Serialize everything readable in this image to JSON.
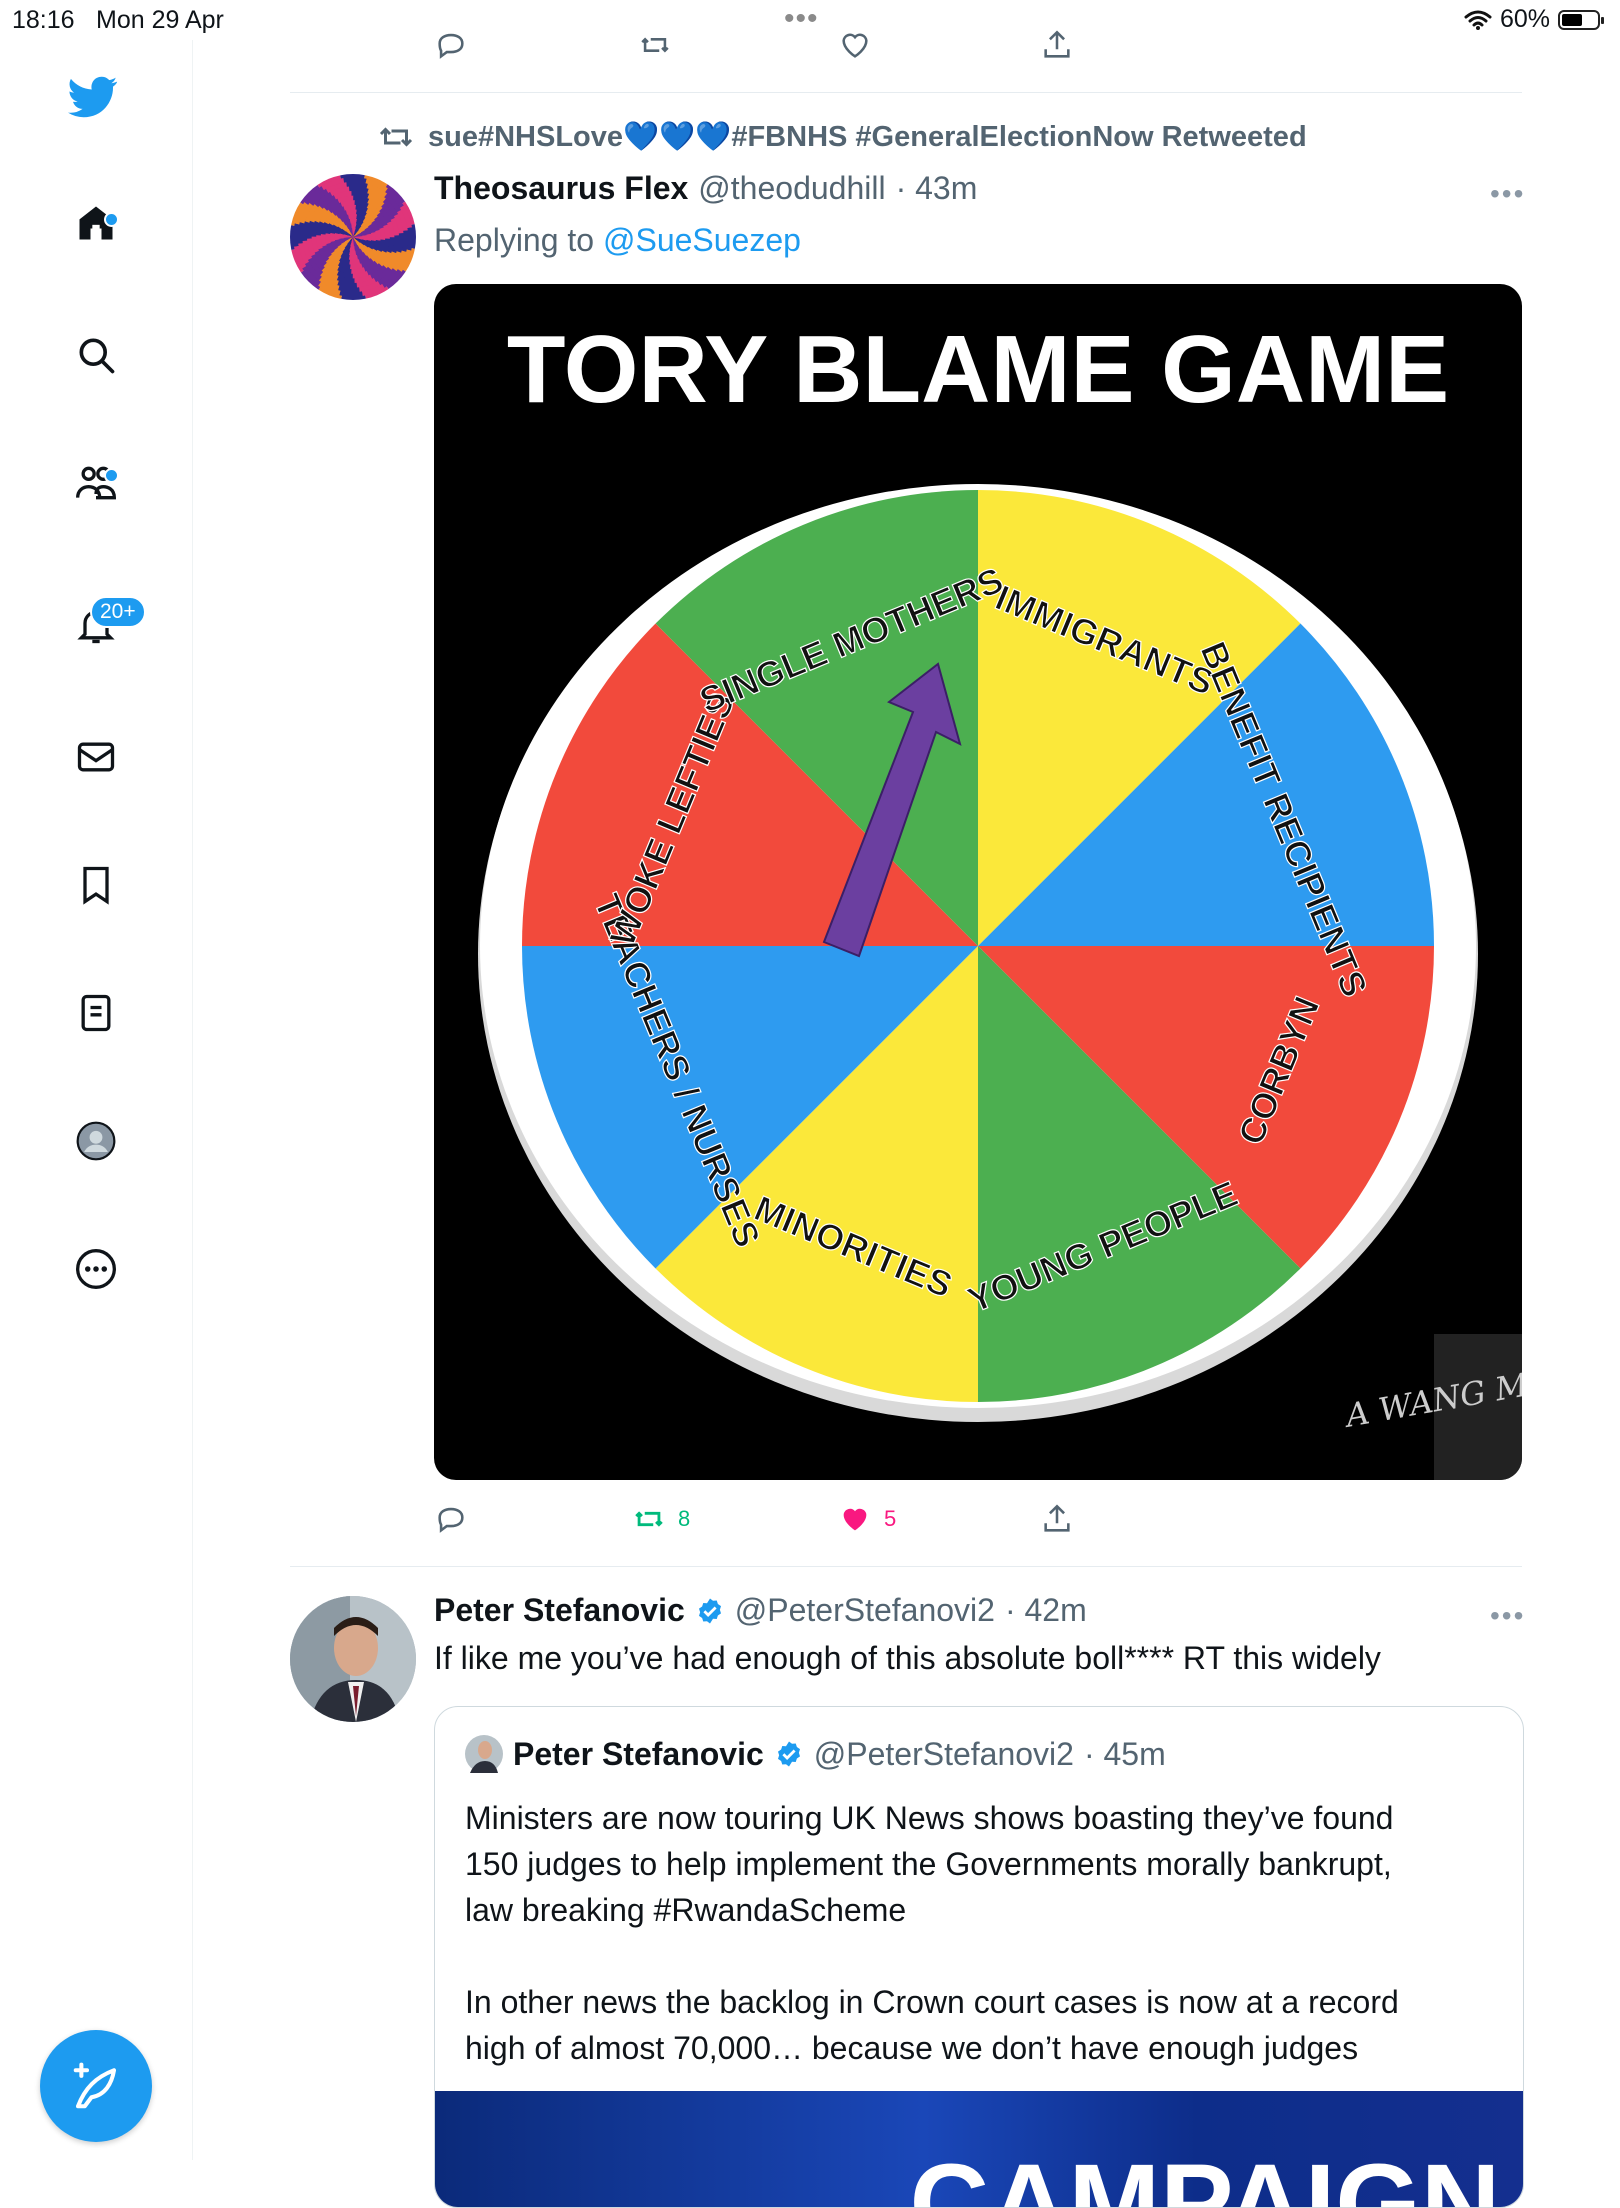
{
  "status_bar": {
    "time": "18:16",
    "date": "Mon 29 Apr",
    "battery": "60%",
    "battery_level": 0.6
  },
  "sidebar": {
    "items": [
      {
        "name": "home",
        "has_dot": true
      },
      {
        "name": "explore"
      },
      {
        "name": "communities",
        "has_dot": true
      },
      {
        "name": "notifications",
        "badge": "20+"
      },
      {
        "name": "messages"
      },
      {
        "name": "bookmarks"
      },
      {
        "name": "lists"
      },
      {
        "name": "profile"
      },
      {
        "name": "more"
      }
    ],
    "notifications_badge": "20+"
  },
  "colors": {
    "accent": "#1d9bf0",
    "retweet_green": "#00ba7c",
    "like_pink": "#f91880",
    "muted": "#536471"
  },
  "tweet1": {
    "retweeted_by": "sue#NHSLove💙💙💙#FBNHS #GeneralElectionNow Retweeted",
    "name": "Theosaurus Flex",
    "handle": "@theodudhill",
    "time": "· 43m",
    "replying_prefix": "Replying to",
    "replying_to": "@SueSuezep",
    "image": {
      "title": "TORY BLAME GAME",
      "segments": [
        "IMMIGRANTS",
        "BENEFIT RECIPIENTS",
        "CORBYN",
        "YOUNG PEOPLE",
        "MINORITIES",
        "TEACHERS / NURSES",
        "WOKE LEFTIES",
        "SINGLE MOTHERS"
      ],
      "watermark": "A WANG MEME"
    },
    "retweets": "8",
    "likes": "5"
  },
  "tweet2": {
    "name": "Peter Stefanovic",
    "handle": "@PeterStefanovi2",
    "time": "· 42m",
    "text": "If like me you’ve had enough of this absolute boll**** RT this widely",
    "quote": {
      "name": "Peter Stefanovic",
      "handle": "@PeterStefanovi2",
      "time": "· 45m",
      "para1_line1": "Ministers are now touring UK News shows boasting they’ve found",
      "para1_line2": "150 judges to help implement the Governments morally bankrupt,",
      "para1_line3": "law breaking #RwandaScheme",
      "para2_line1": "In other news the backlog in Crown court cases is now at a record",
      "para2_line2": "high of almost 70,000… because we don’t have enough judges",
      "image_text": "CAMPAIGN"
    }
  }
}
